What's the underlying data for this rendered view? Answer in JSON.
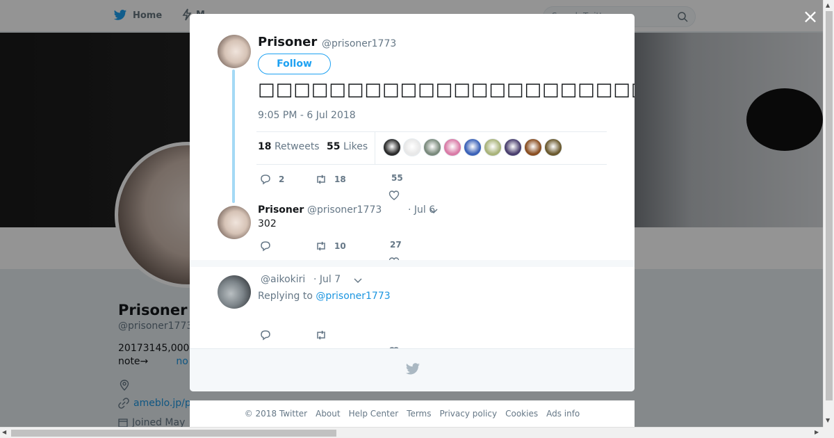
{
  "nav": {
    "home_label": "Home",
    "moments_label": "M",
    "search_placeholder": "Search Twitter"
  },
  "profile": {
    "name": "Prisoner",
    "handle": "@prisoner1773",
    "bio_line1": "20173145,000",
    "bio_line2_prefix": "note→",
    "bio_line2_link": "no",
    "url": "ameblo.jp/p",
    "joined": "Joined May"
  },
  "modal": {
    "close_label": "×",
    "main_tweet": {
      "name": "Prisoner",
      "handle": "@prisoner1773",
      "follow_label": "Follow",
      "text": "□□□□□□□□□□□□□□□□□□□□□□□□□□□□□□□□□□□□□□□□□□□□□□□□□□□□□□□□□□□□",
      "timestamp": "9:05 PM - 6 Jul 2018",
      "retweets_count": "18",
      "retweets_label": "Retweets",
      "likes_count": "55",
      "likes_label": "Likes",
      "liker_colors": [
        "#2b2b2b",
        "#e8e8e8",
        "#7a8a7c",
        "#d97aa6",
        "#3b62b8",
        "#a9b37a",
        "#4a3f6e",
        "#8a4f22",
        "#6b5a2f"
      ],
      "reply_count": "2",
      "retweet_count": "18",
      "like_count": "55"
    },
    "reply_1": {
      "name": "Prisoner",
      "handle": "@prisoner1773",
      "date": "· Jul 6",
      "text": "302",
      "retweet_count": "10",
      "like_count": "27"
    },
    "reply_2": {
      "handle": "@aikokiri",
      "date": "· Jul 7",
      "replying_prefix": "Replying to",
      "replying_mention": "@prisoner1773"
    }
  },
  "footer": {
    "links": [
      "© 2018 Twitter",
      "About",
      "Help Center",
      "Terms",
      "Privacy policy",
      "Cookies",
      "Ads info"
    ]
  },
  "colors": {
    "accent": "#1da1f2",
    "thread_line": "#a4d9f5",
    "link": "#1b95e0"
  }
}
